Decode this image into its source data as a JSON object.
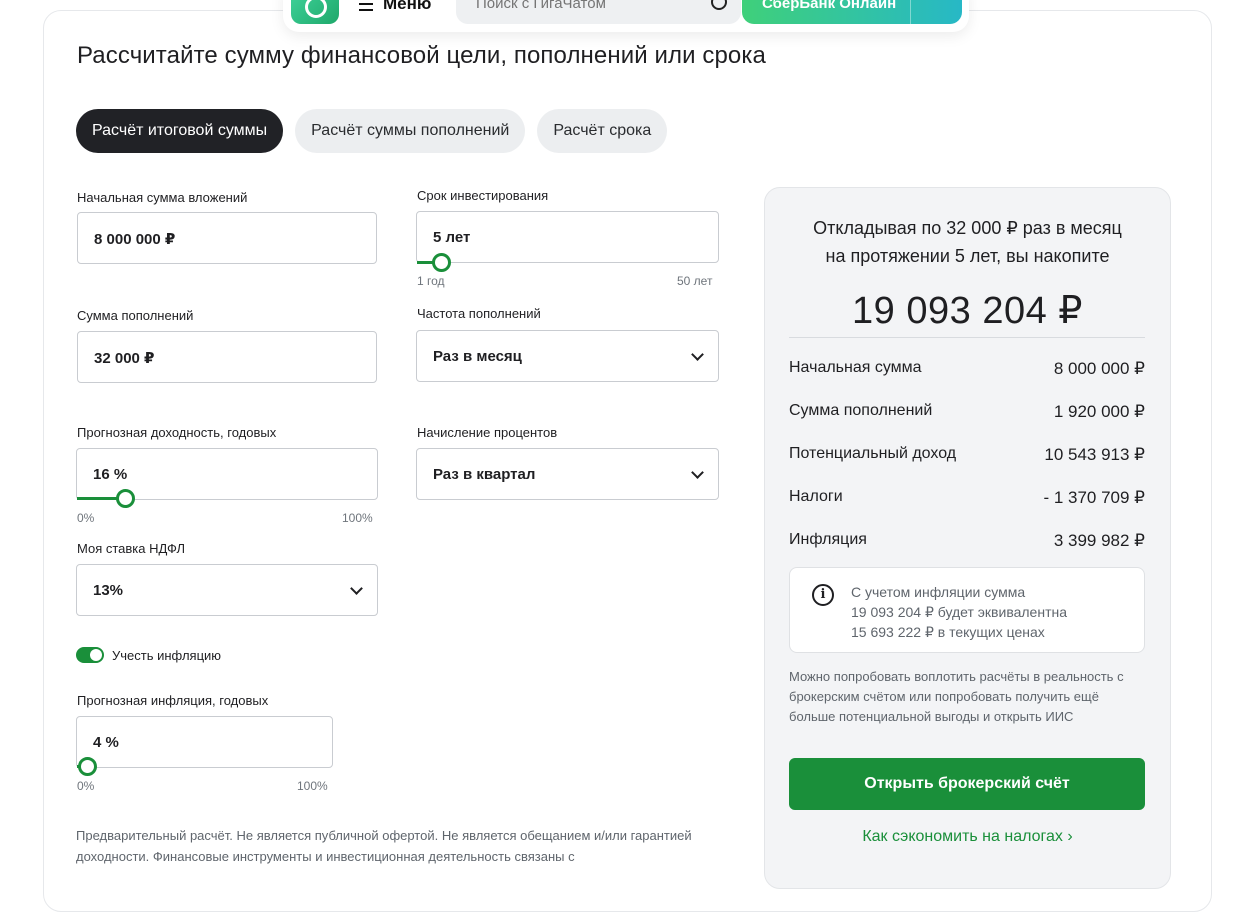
{
  "header": {
    "menu_label": "Меню",
    "search_placeholder": "Поиск с ГигаЧатом",
    "online_label": "СберБанк Онлайн"
  },
  "title": "Рассчитайте сумму финансовой цели, пополнений или срока",
  "tabs": [
    {
      "label": "Расчёт итоговой суммы",
      "active": true
    },
    {
      "label": "Расчёт суммы пополнений",
      "active": false
    },
    {
      "label": "Расчёт срока",
      "active": false
    }
  ],
  "form": {
    "initial_amount": {
      "label": "Начальная сумма вложений",
      "value": "8 000 000 ₽"
    },
    "term": {
      "label": "Срок инвестирования",
      "value": "5 лет",
      "min_label": "1 год",
      "max_label": "50 лет",
      "level": 0.08
    },
    "contribution": {
      "label": "Сумма пополнений",
      "value": "32 000 ₽"
    },
    "frequency": {
      "label": "Частота пополнений",
      "value": "Раз в месяц"
    },
    "yield": {
      "label": "Прогнозная доходность, годовых",
      "value": "16 %",
      "min_label": "0%",
      "max_label": "100%",
      "level": 0.16
    },
    "interest": {
      "label": "Начисление процентов",
      "value": "Раз в квартал"
    },
    "tax_rate": {
      "label": "Моя ставка НДФЛ",
      "value": "13%"
    },
    "inflation_toggle": {
      "label": "Учесть инфляцию",
      "on": true
    },
    "inflation": {
      "label": "Прогнозная инфляция, годовых",
      "value": "4 %",
      "min_label": "0%",
      "max_label": "100%",
      "level": 0.04
    }
  },
  "disclaimer": "Предварительный расчёт. Не является публичной офертой. Не является обещанием и/или гарантией доходности. Финансовые инструменты и инвестиционная деятельность связаны с",
  "result": {
    "head_line1": "Откладывая по 32 000 ₽ раз в месяц",
    "head_line2": "на протяжении 5 лет, вы накопите",
    "total": "19 093 204 ₽",
    "rows": [
      {
        "label": "Начальная сумма",
        "value": "8 000 000 ₽"
      },
      {
        "label": "Сумма пополнений",
        "value": "1 920 000 ₽"
      },
      {
        "label": "Потенциальный доход",
        "value": "10 543 913 ₽"
      },
      {
        "label": "Налоги",
        "value": "- 1 370 709 ₽"
      },
      {
        "label": "Инфляция",
        "value": "3 399 982 ₽"
      }
    ],
    "info_line1": "С учетом инфляции сумма",
    "info_line2": "19 093 204 ₽ будет эквивалентна",
    "info_line3": "15 693 222 ₽ в текущих ценах",
    "note": "Можно попробовать воплотить расчёты в реальность с брокерским счётом или попробовать получить ещё больше потенциальной выгоды и открыть ИИС",
    "cta_label": "Открыть брокерский счёт",
    "tax_link": "Как сэкономить на налогах ›"
  },
  "colors": {
    "accent": "#1a8f3a",
    "tab_active": "#212226"
  }
}
